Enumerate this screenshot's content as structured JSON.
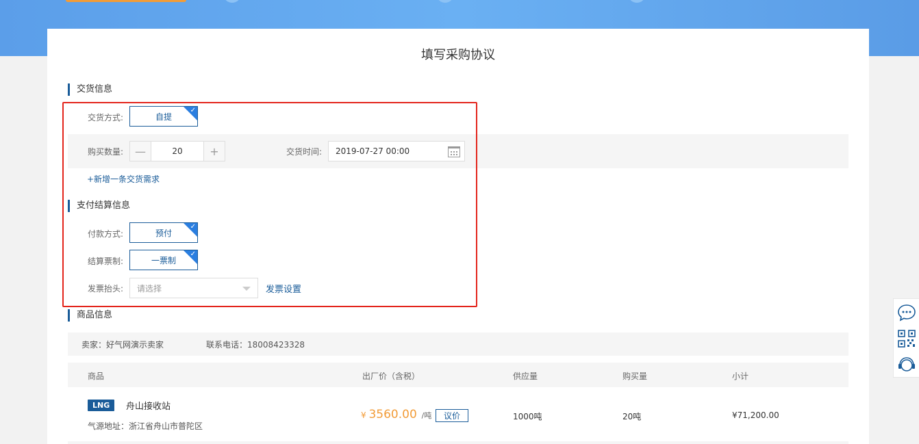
{
  "page": {
    "title": "填写采购协议"
  },
  "delivery": {
    "section_title": "交货信息",
    "method_label": "交货方式:",
    "method_value": "自提",
    "quantity_label": "购买数量:",
    "quantity_value": "20",
    "time_label": "交货时间:",
    "time_value": "2019-07-27 00:00",
    "add_link": "+新增一条交货需求"
  },
  "payment": {
    "section_title": "支付结算信息",
    "pay_method_label": "付款方式:",
    "pay_method_value": "预付",
    "settle_label": "结算票制:",
    "settle_value": "一票制",
    "invoice_label": "发票抬头:",
    "invoice_placeholder": "请选择",
    "invoice_settings": "发票设置"
  },
  "goods": {
    "section_title": "商品信息",
    "seller": "卖家：好气网演示卖家",
    "phone": "联系电话：18008423328",
    "columns": [
      "商品",
      "出厂价（含税）",
      "供应量",
      "购买量",
      "小计"
    ],
    "product": {
      "badge": "LNG",
      "name": "舟山接收站",
      "origin": "气源地址：浙江省舟山市普陀区",
      "price_symbol": "¥",
      "price": "3560.00",
      "price_unit": "/吨",
      "negotiate": "议价",
      "supply": "1000吨",
      "purchase": "20吨",
      "subtotal": "¥71,200.00"
    }
  },
  "icons": {
    "chat": "chat-bubble-icon",
    "qr": "qr-code-icon",
    "service": "customer-service-icon",
    "calendar": "calendar-icon",
    "check": "check-icon",
    "dropdown": "chevron-down-icon"
  },
  "colors": {
    "primary": "#1a5c99",
    "accent": "#2a7ee0",
    "price": "#f29c38",
    "highlight": "#e3241b"
  }
}
